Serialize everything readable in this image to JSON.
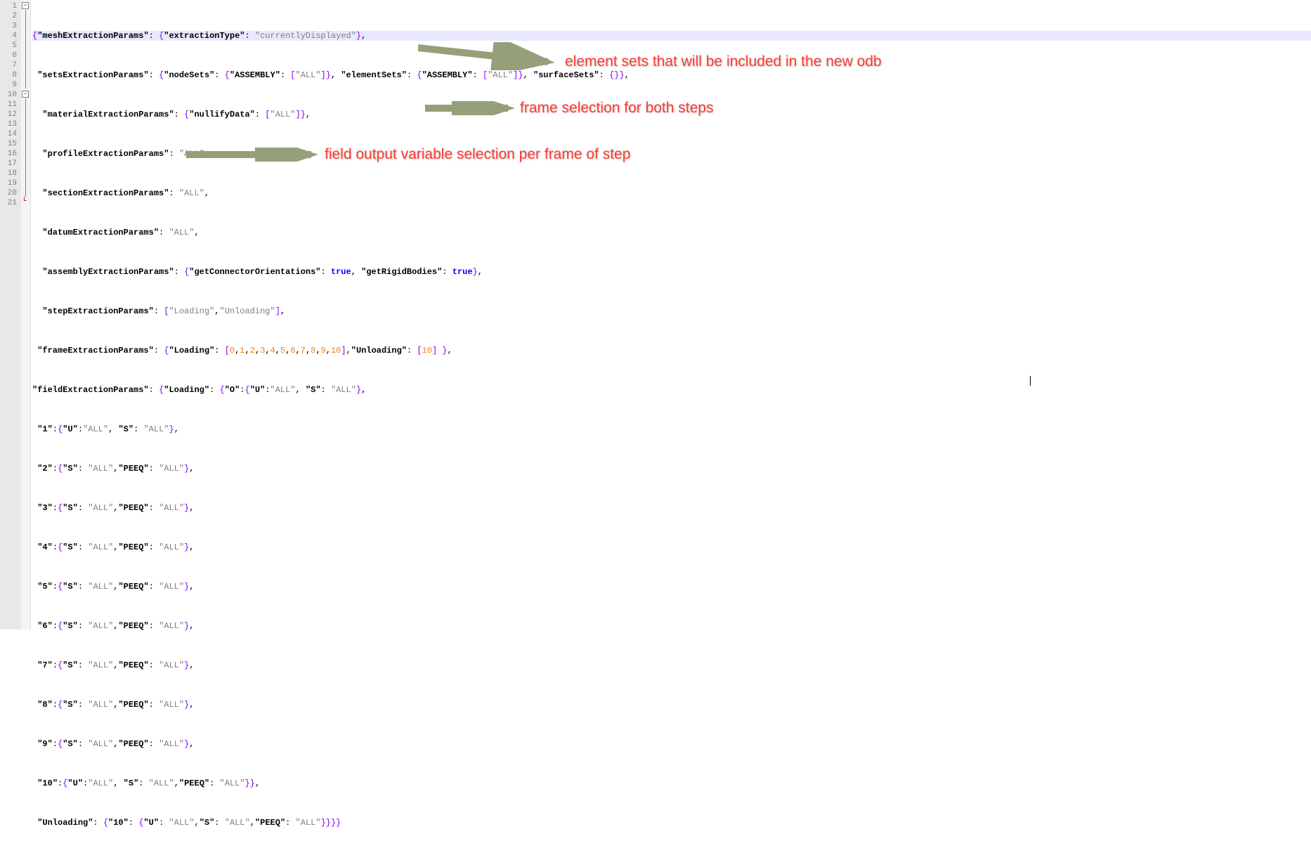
{
  "gutter": {
    "lines": [
      "1",
      "2",
      "3",
      "4",
      "5",
      "6",
      "7",
      "8",
      "9",
      "10",
      "11",
      "12",
      "13",
      "14",
      "15",
      "16",
      "17",
      "18",
      "19",
      "20",
      "21"
    ]
  },
  "fold": {
    "openers": [
      0,
      9
    ],
    "closer": 20
  },
  "annotations": {
    "a1": "element sets that will be included in the new odb",
    "a2": "frame selection for both steps",
    "a3": "field output variable selection per frame of step"
  },
  "colors": {
    "string": "#808080",
    "number": "#ff8000",
    "keyword": "#0000ff",
    "brace": "#8000ff",
    "annotation": "#ff3b30",
    "gutter_bg": "#e8e8e8",
    "highlight_bg": "#e8e8ff"
  },
  "code": {
    "line1_meshExtractionParams": "meshExtractionParams",
    "line1_extractionType": "extractionType",
    "line1_currentlyDisplayed": "currentlyDisplayed",
    "line2_setsExtractionParams": "setsExtractionParams",
    "line2_nodeSets": "nodeSets",
    "line2_ASSEMBLY": "ASSEMBLY",
    "line2_ALL": "ALL",
    "line2_elementSets": "elementSets",
    "line2_surfaceSets": "surfaceSets",
    "line3_materialExtractionParams": "materialExtractionParams",
    "line3_nullifyData": "nullifyData",
    "line4_profileExtractionParams": "profileExtractionParams",
    "line5_sectionExtractionParams": "sectionExtractionParams",
    "line6_datumExtractionParams": "datumExtractionParams",
    "line7_assemblyExtractionParams": "assemblyExtractionParams",
    "line7_getConnectorOrientations": "getConnectorOrientations",
    "line7_getRigidBodies": "getRigidBodies",
    "line8_stepExtractionParams": "stepExtractionParams",
    "line8_Loading": "Loading",
    "line8_Unloading": "Unloading",
    "line9_frameExtractionParams": "frameExtractionParams",
    "line10_fieldExtractionParams": "fieldExtractionParams",
    "U": "U",
    "S": "S",
    "PEEQ": "PEEQ",
    "ALL": "ALL",
    "n0": "0",
    "n1": "1",
    "n2": "2",
    "n3": "3",
    "n4": "4",
    "n5": "5",
    "n6": "6",
    "n7": "7",
    "n8": "8",
    "n9": "9",
    "n10": "10",
    "kTrue": "true",
    "frame_keys": {
      "k1": "1",
      "k2": "2",
      "k3": "3",
      "k4": "4",
      "k5": "5",
      "k6": "6",
      "k7": "7",
      "k8": "8",
      "k9": "9",
      "k10": "10",
      "kO": "O"
    }
  }
}
